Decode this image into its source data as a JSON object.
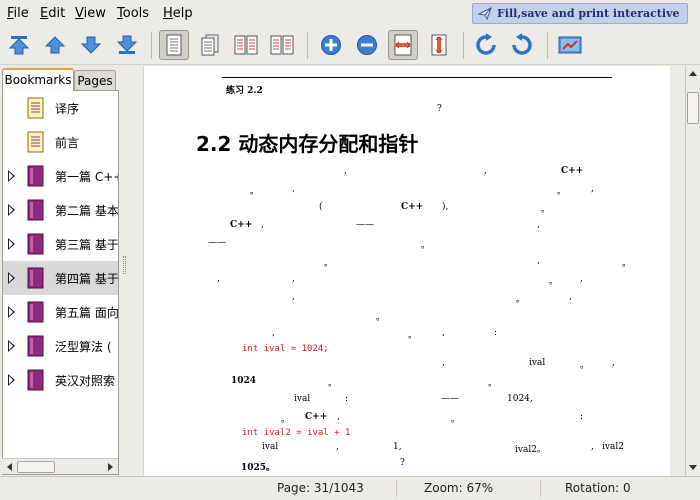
{
  "menu": {
    "items": [
      {
        "mnemonic": "F",
        "rest": "ile"
      },
      {
        "mnemonic": "E",
        "rest": "dit"
      },
      {
        "mnemonic": "V",
        "rest": "iew"
      },
      {
        "mnemonic": "T",
        "rest": "ools"
      },
      {
        "mnemonic": "H",
        "rest": "elp"
      }
    ],
    "promo": "Fill,save and print interactive forms!"
  },
  "toolbar": {
    "icons": [
      "first-page-icon",
      "previous-page-icon",
      "next-page-icon",
      "last-page-icon",
      "single-page-icon",
      "continuous-page-icon",
      "facing-pages-icon",
      "continuous-facing-icon",
      "zoom-in-icon",
      "zoom-out-icon",
      "fit-width-icon",
      "fit-page-icon",
      "rotate-clockwise-icon",
      "rotate-counterclockwise-icon",
      "present-icon"
    ],
    "accent": "#3a7fd3"
  },
  "sidebar": {
    "tabs": {
      "bookmarks": "Bookmarks",
      "pages": "Pages"
    },
    "items": [
      {
        "label": "译序",
        "expandable": false
      },
      {
        "label": "前言",
        "expandable": false
      },
      {
        "label": "第一篇 C++",
        "expandable": true
      },
      {
        "label": "第二篇 基本",
        "expandable": true
      },
      {
        "label": "第三篇 基于",
        "expandable": true
      },
      {
        "label": "第四篇 基于",
        "expandable": true,
        "selected": true
      },
      {
        "label": "第五篇 面向",
        "expandable": true
      },
      {
        "label": "泛型算法 (",
        "expandable": true
      },
      {
        "label": "英汉对照索",
        "expandable": true
      }
    ]
  },
  "document": {
    "header": "练习 2.2",
    "section_title": "2.2  动态内存分配和指针",
    "fragments": {
      "q1": "?",
      "p1_comma1": ",",
      "p1_comma2": ",",
      "p1_cpp": "C++",
      "p2_dot1": "。",
      "p2_comma1": ",",
      "p2_dot2": "。",
      "p2_comma2": ",",
      "p3_paren_open": "(",
      "p3_cpp": "C++",
      "p3_paren_close": "),",
      "p3_dot": "。",
      "p4_cpp": "C++",
      "p4_comma": ",",
      "p4_dash": "——",
      "p4_comma2": ",",
      "p5_dash": "——",
      "p5_dot": "。",
      "p6_dot": "。",
      "p6_comma": ",",
      "p6_dot2": "。",
      "p7_comma": ",",
      "p7_comma2": ",",
      "p7_dot": "。",
      "p7_comma3": ",",
      "p8_comma": ",",
      "p8_dot": "。",
      "p8_comma2": ",",
      "p9_dot": "。",
      "p10_comma": ",",
      "p10_dot": "。",
      "p10_comma2": ",",
      "p10_colon": ":",
      "code1": "int ival = 1024;",
      "p11_comma": ",",
      "p11_ival": "ival",
      "p11_dot": "。",
      "p11_comma2": ",",
      "p12_1024": "1024",
      "p12_dot": "。",
      "p12_dot2": "。",
      "p13_ival": "ival",
      "p13_colon": ":",
      "p13_dash": "——",
      "p13_1024": "1024,",
      "p14_dot": "。",
      "p14_cpp": "C++",
      "p14_comma": ",",
      "p14_dot2": "。",
      "p14_colon": ":",
      "code2": "int ival2 = ival + 1",
      "p15_ival": "ival",
      "p15_comma": ",",
      "p15_1": "1,",
      "p15_ival2": "ival2。",
      "p15_ival2b": "ival2",
      "p15_comma2": ",",
      "p16_1025": "1025。",
      "p16_q": "?"
    }
  },
  "status": {
    "page": "Page: 31/1043",
    "zoom": "Zoom: 67%",
    "rotation": "Rotation: 0"
  }
}
